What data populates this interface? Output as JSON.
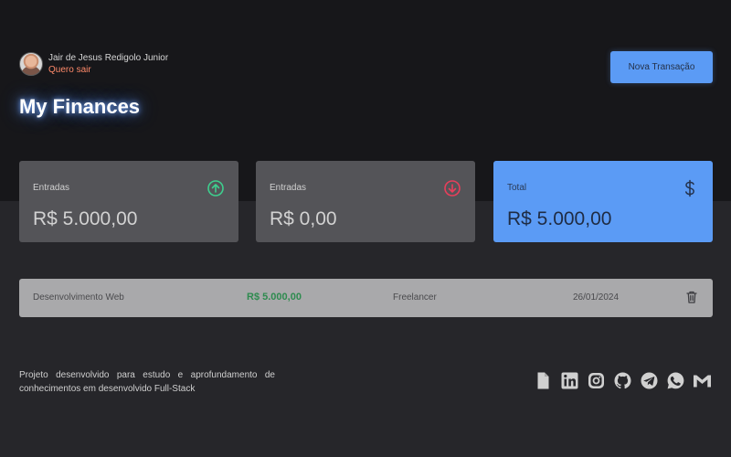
{
  "user": {
    "name": "Jair de Jesus Redigolo Junior",
    "logout_label": "Quero sair"
  },
  "header": {
    "new_transaction_label": "Nova Transação"
  },
  "page_title": "My Finances",
  "summary": {
    "income": {
      "label": "Entradas",
      "value": "R$ 5.000,00",
      "icon": "arrow-circle-up-icon",
      "color": "#3ecf8e"
    },
    "outcome": {
      "label": "Entradas",
      "value": "R$ 0,00",
      "icon": "arrow-circle-down-icon",
      "color": "#e83f5b"
    },
    "total": {
      "label": "Total",
      "value": "R$ 5.000,00",
      "icon": "dollar-sign-icon",
      "color": "#5b9bf5"
    }
  },
  "transactions": [
    {
      "title": "Desenvolvimento Web",
      "amount": "R$ 5.000,00",
      "category": "Freelancer",
      "date": "26/01/2024"
    }
  ],
  "footer": {
    "text": "Projeto desenvolvido para estudo e aprofundamento de conhecimentos em desenvolvido Full-Stack",
    "social_icons": [
      "file-icon",
      "linkedin-icon",
      "instagram-icon",
      "github-icon",
      "telegram-icon",
      "whatsapp-icon",
      "gmail-icon"
    ]
  }
}
